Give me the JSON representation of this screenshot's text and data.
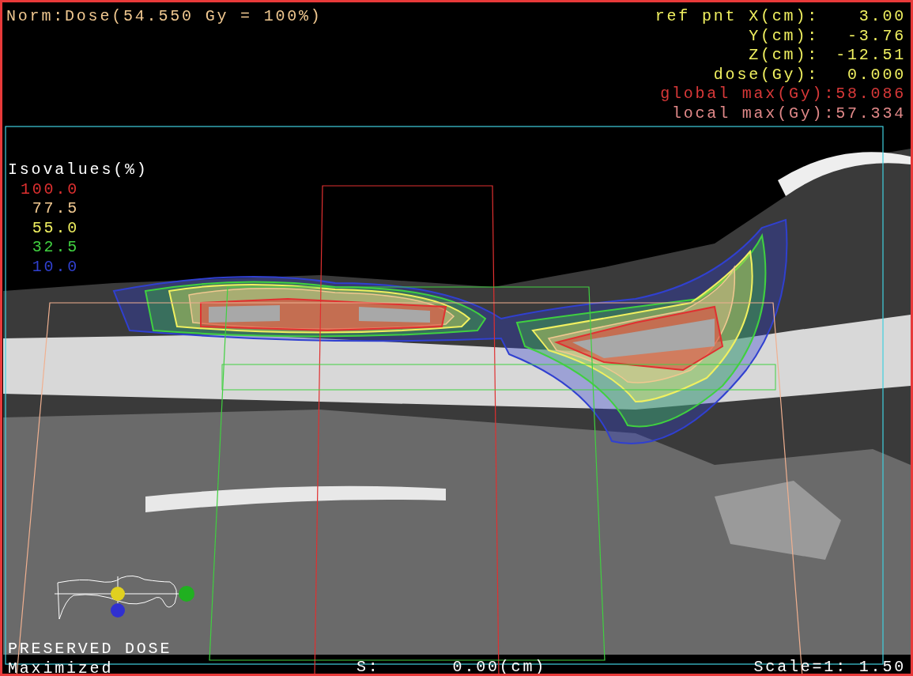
{
  "norm_label": "Norm:Dose(54.550 Gy = 100%)",
  "ref_point": [
    {
      "label": "ref pnt X(cm):",
      "value": "3.00",
      "color": "#f0f060"
    },
    {
      "label": "Y(cm):",
      "value": "-3.76",
      "color": "#f0f060"
    },
    {
      "label": "Z(cm):",
      "value": "-12.51",
      "color": "#f0f060"
    },
    {
      "label": "dose(Gy):",
      "value": "0.000",
      "color": "#f0f060"
    },
    {
      "label": "global max(Gy)",
      "value": ":58.086",
      "color": "#d83838"
    },
    {
      "label": "local max(Gy)",
      "value": ":57.334",
      "color": "#e08888"
    }
  ],
  "isovalues": {
    "title": "Isovalues(%)",
    "levels": [
      {
        "value": "100.0",
        "color": "#e03030"
      },
      {
        "value": "77.5",
        "color": "#f0c890"
      },
      {
        "value": "55.0",
        "color": "#f0f060"
      },
      {
        "value": "32.5",
        "color": "#40d040"
      },
      {
        "value": "10.0",
        "color": "#3040d0"
      }
    ]
  },
  "status": {
    "mode": "PRESERVED DOSE",
    "view": "Maximized",
    "slice_label": "S:",
    "slice_value": "0.00(cm)",
    "scale": "Scale=1: 1.50"
  }
}
